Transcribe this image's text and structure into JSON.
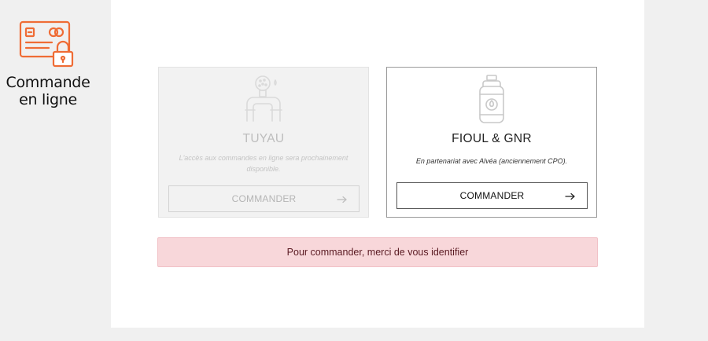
{
  "sidebar": {
    "icon": "credit-card-lock-icon",
    "label_line1": "Commande",
    "label_line2": "en ligne",
    "accent": "#ef6c35"
  },
  "cards": {
    "tuyau": {
      "icon": "pipe-water-icon",
      "title": "TUYAU",
      "description": "L'accès aux commandes en ligne sera prochainement disponible.",
      "button_label": "COMMANDER",
      "disabled": true
    },
    "fioul": {
      "icon": "gas-bottle-icon",
      "title": "FIOUL & GNR",
      "description": "En partenariat avec Alvéa (anciennement CPO).",
      "button_label": "COMMANDER",
      "disabled": false
    }
  },
  "alert": {
    "text": "Pour commander, merci de vous identifier",
    "bg": "#f8d7da"
  }
}
